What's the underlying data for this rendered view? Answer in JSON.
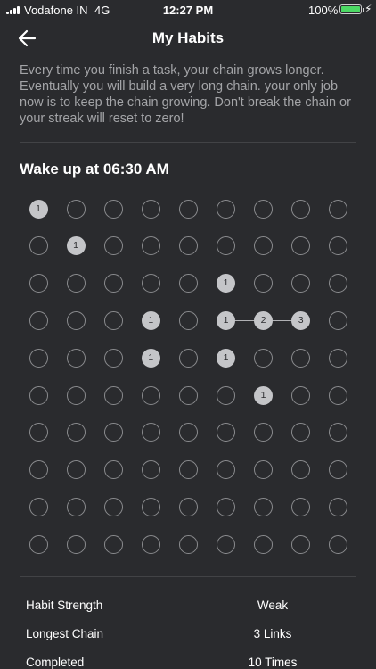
{
  "status_bar": {
    "carrier": "Vodafone IN",
    "network": "4G",
    "time": "12:27 PM",
    "battery_percent": "100%",
    "battery_level": 1.0,
    "charging_icon": "bolt-icon"
  },
  "header": {
    "back_icon": "arrow-left-icon",
    "title": "My Habits"
  },
  "description": "Every time you finish a task, your chain grows longer. Eventually you will build a very long chain. your only job now is to keep the chain growing. Don't break the chain or your streak will reset to zero!",
  "habit": {
    "name": "Wake up at 06:30 AM",
    "grid": {
      "rows": 10,
      "columns": 9,
      "filled": [
        {
          "row": 0,
          "col": 0,
          "label": "1"
        },
        {
          "row": 1,
          "col": 1,
          "label": "1"
        },
        {
          "row": 2,
          "col": 5,
          "label": "1"
        },
        {
          "row": 3,
          "col": 3,
          "label": "1"
        },
        {
          "row": 3,
          "col": 5,
          "label": "1"
        },
        {
          "row": 3,
          "col": 6,
          "label": "2"
        },
        {
          "row": 3,
          "col": 7,
          "label": "3"
        },
        {
          "row": 4,
          "col": 3,
          "label": "1"
        },
        {
          "row": 4,
          "col": 5,
          "label": "1"
        },
        {
          "row": 5,
          "col": 6,
          "label": "1"
        }
      ],
      "links": [
        {
          "row": 3,
          "from_col": 5,
          "to_col": 7
        }
      ]
    }
  },
  "stats": [
    {
      "label": "Habit Strength",
      "value": "Weak"
    },
    {
      "label": "Longest Chain",
      "value": "3 Links"
    },
    {
      "label": "Completed",
      "value": "10 Times"
    }
  ],
  "colors": {
    "background": "#2a2b2e",
    "filled_cell": "#c4c5c8",
    "empty_cell_border": "#8a8b8e",
    "battery": "#4cd964",
    "description_text": "#a3a4a7"
  }
}
